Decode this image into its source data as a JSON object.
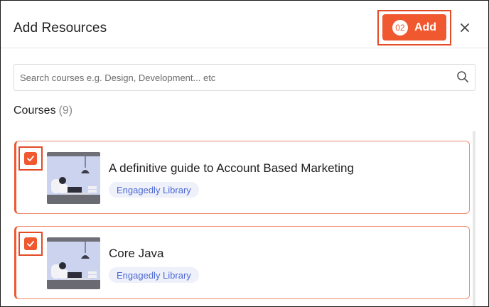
{
  "header": {
    "title": "Add Resources",
    "add_count": "02",
    "add_label": "Add"
  },
  "search": {
    "placeholder": "Search courses e.g. Design, Development... etc"
  },
  "section": {
    "title": "Courses",
    "count": "(9)"
  },
  "courses": [
    {
      "title": "A definitive guide to Account Based Marketing",
      "tag": "Engagedly Library",
      "selected": true
    },
    {
      "title": "Core Java",
      "tag": "Engagedly Library",
      "selected": true
    }
  ],
  "colors": {
    "accent": "#f0582f",
    "highlight_box": "#e24b26",
    "tag_text": "#4d6ad6",
    "tag_bg": "#eef0fa"
  },
  "icons": [
    "close-icon",
    "search-icon",
    "check-icon"
  ]
}
